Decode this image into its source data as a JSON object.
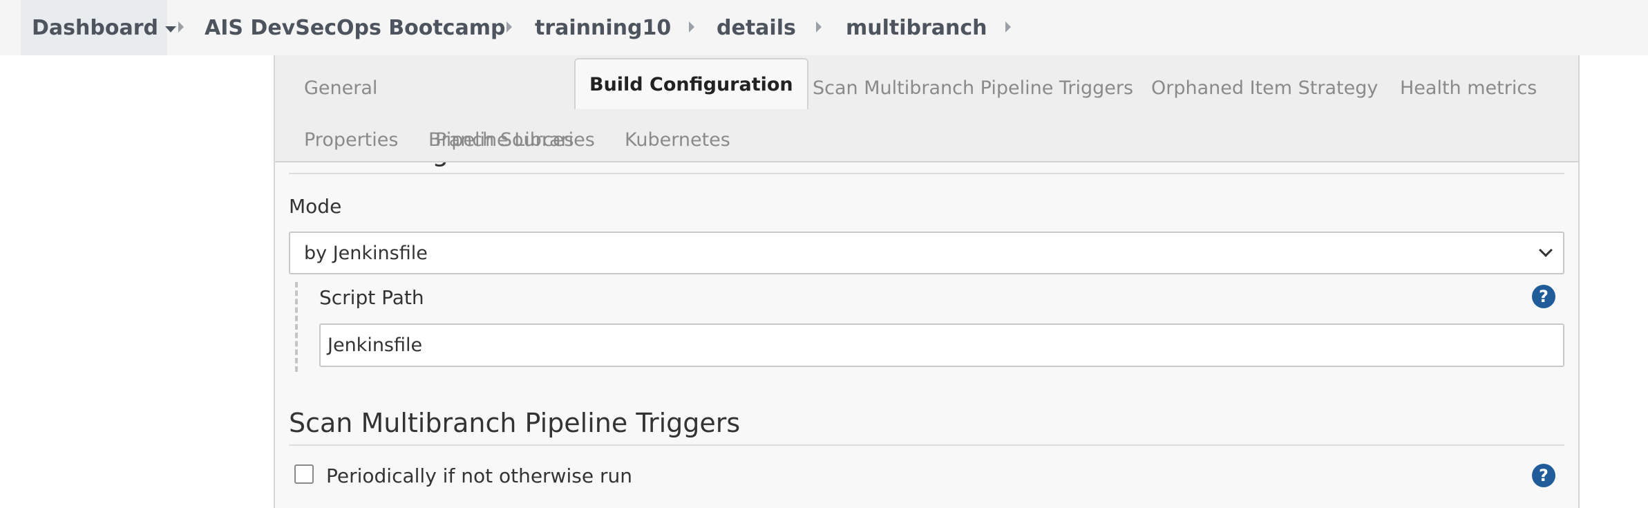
{
  "breadcrumb": {
    "items": [
      {
        "label": "Dashboard"
      },
      {
        "label": "AIS DevSecOps Bootcamp"
      },
      {
        "label": "trainning10"
      },
      {
        "label": "details"
      },
      {
        "label": "multibranch"
      }
    ]
  },
  "tabs": [
    {
      "label": "General",
      "active": false
    },
    {
      "label": "Branch Sources",
      "active": false
    },
    {
      "label": "Build Configuration",
      "active": true
    },
    {
      "label": "Scan Multibranch Pipeline Triggers",
      "active": false
    },
    {
      "label": "Orphaned Item Strategy",
      "active": false
    },
    {
      "label": "Health metrics",
      "active": false
    },
    {
      "label": "Properties",
      "active": false
    },
    {
      "label": "Pipeline Libraries",
      "active": false
    },
    {
      "label": "Kubernetes",
      "active": false
    }
  ],
  "build_configuration": {
    "section_title": "Build Configuration",
    "mode_label": "Mode",
    "mode_value": "by Jenkinsfile",
    "script_path_label": "Script Path",
    "script_path_value": "Jenkinsfile"
  },
  "scan_triggers": {
    "section_title": "Scan Multibranch Pipeline Triggers",
    "periodic_label": "Periodically if not otherwise run",
    "periodic_checked": false
  },
  "icons": {
    "help": "help-icon",
    "help_glyph": "?",
    "help_color": "#1f5c99"
  }
}
